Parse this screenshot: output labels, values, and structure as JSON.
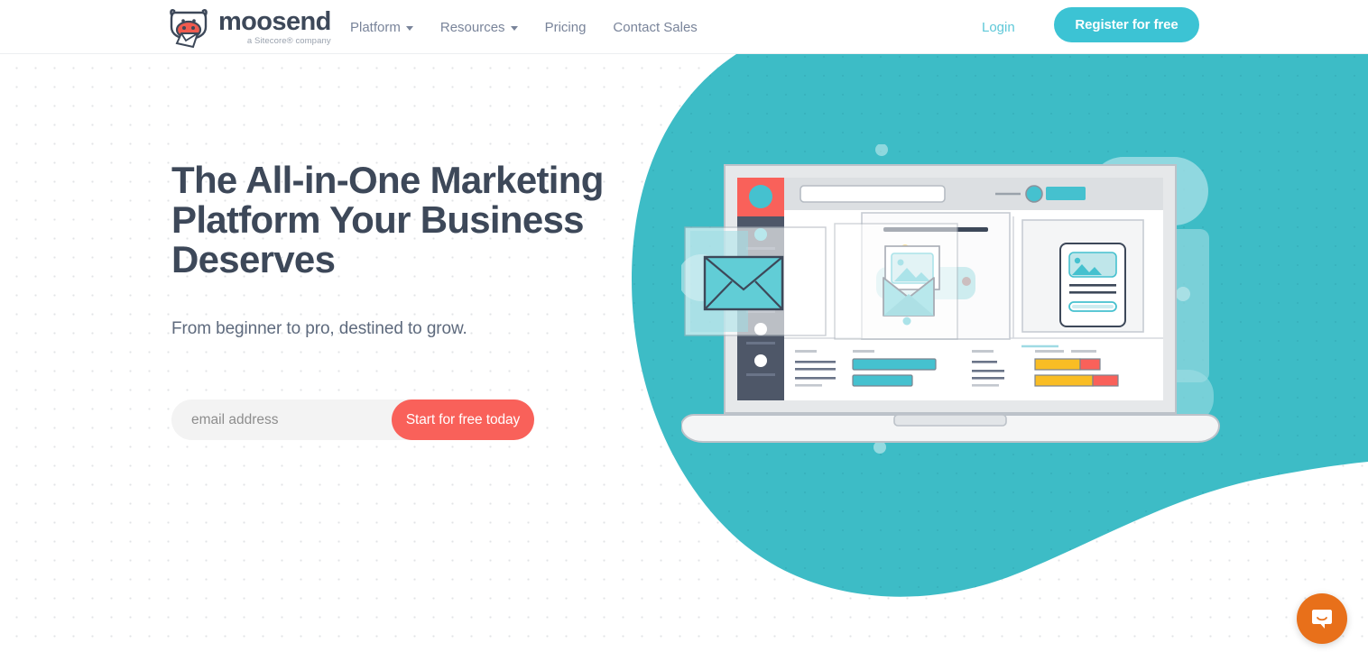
{
  "header": {
    "logo": {
      "icon": "moosend-cow-logo",
      "wordmark": "moosend",
      "tagline": "a Sitecore® company"
    },
    "nav": [
      {
        "label": "Platform",
        "has_dropdown": true,
        "icon": "chevron-down-icon"
      },
      {
        "label": "Resources",
        "has_dropdown": true,
        "icon": "chevron-down-icon"
      },
      {
        "label": "Pricing",
        "has_dropdown": false
      },
      {
        "label": "Contact Sales",
        "has_dropdown": false
      }
    ],
    "login_label": "Login",
    "register_label": "Register for free"
  },
  "hero": {
    "title": "The All-in-One Marketing Platform Your Business Deserves",
    "subtitle": "From beginner to pro, destined to grow.",
    "form": {
      "email_placeholder": "email address",
      "email_value": "",
      "cta_label": "Start for free today"
    },
    "illustration": {
      "name": "laptop-email-marketing-illustration",
      "description": "Laptop displaying an email marketing dashboard with envelopes, image cards and bar charts"
    }
  },
  "chat": {
    "icon": "intercom-chat-bubble-icon",
    "label": "Open Intercom Messenger"
  },
  "colors": {
    "teal_blob": "#3dbcc6",
    "brand_teal": "#3cc3d4",
    "accent_coral": "#f9615a",
    "heading_navy": "#3d4859",
    "nav_text": "#79849a",
    "chat_orange": "#e8701a",
    "chart_yellow": "#f9bd24",
    "input_bg": "#f3f3f3"
  }
}
